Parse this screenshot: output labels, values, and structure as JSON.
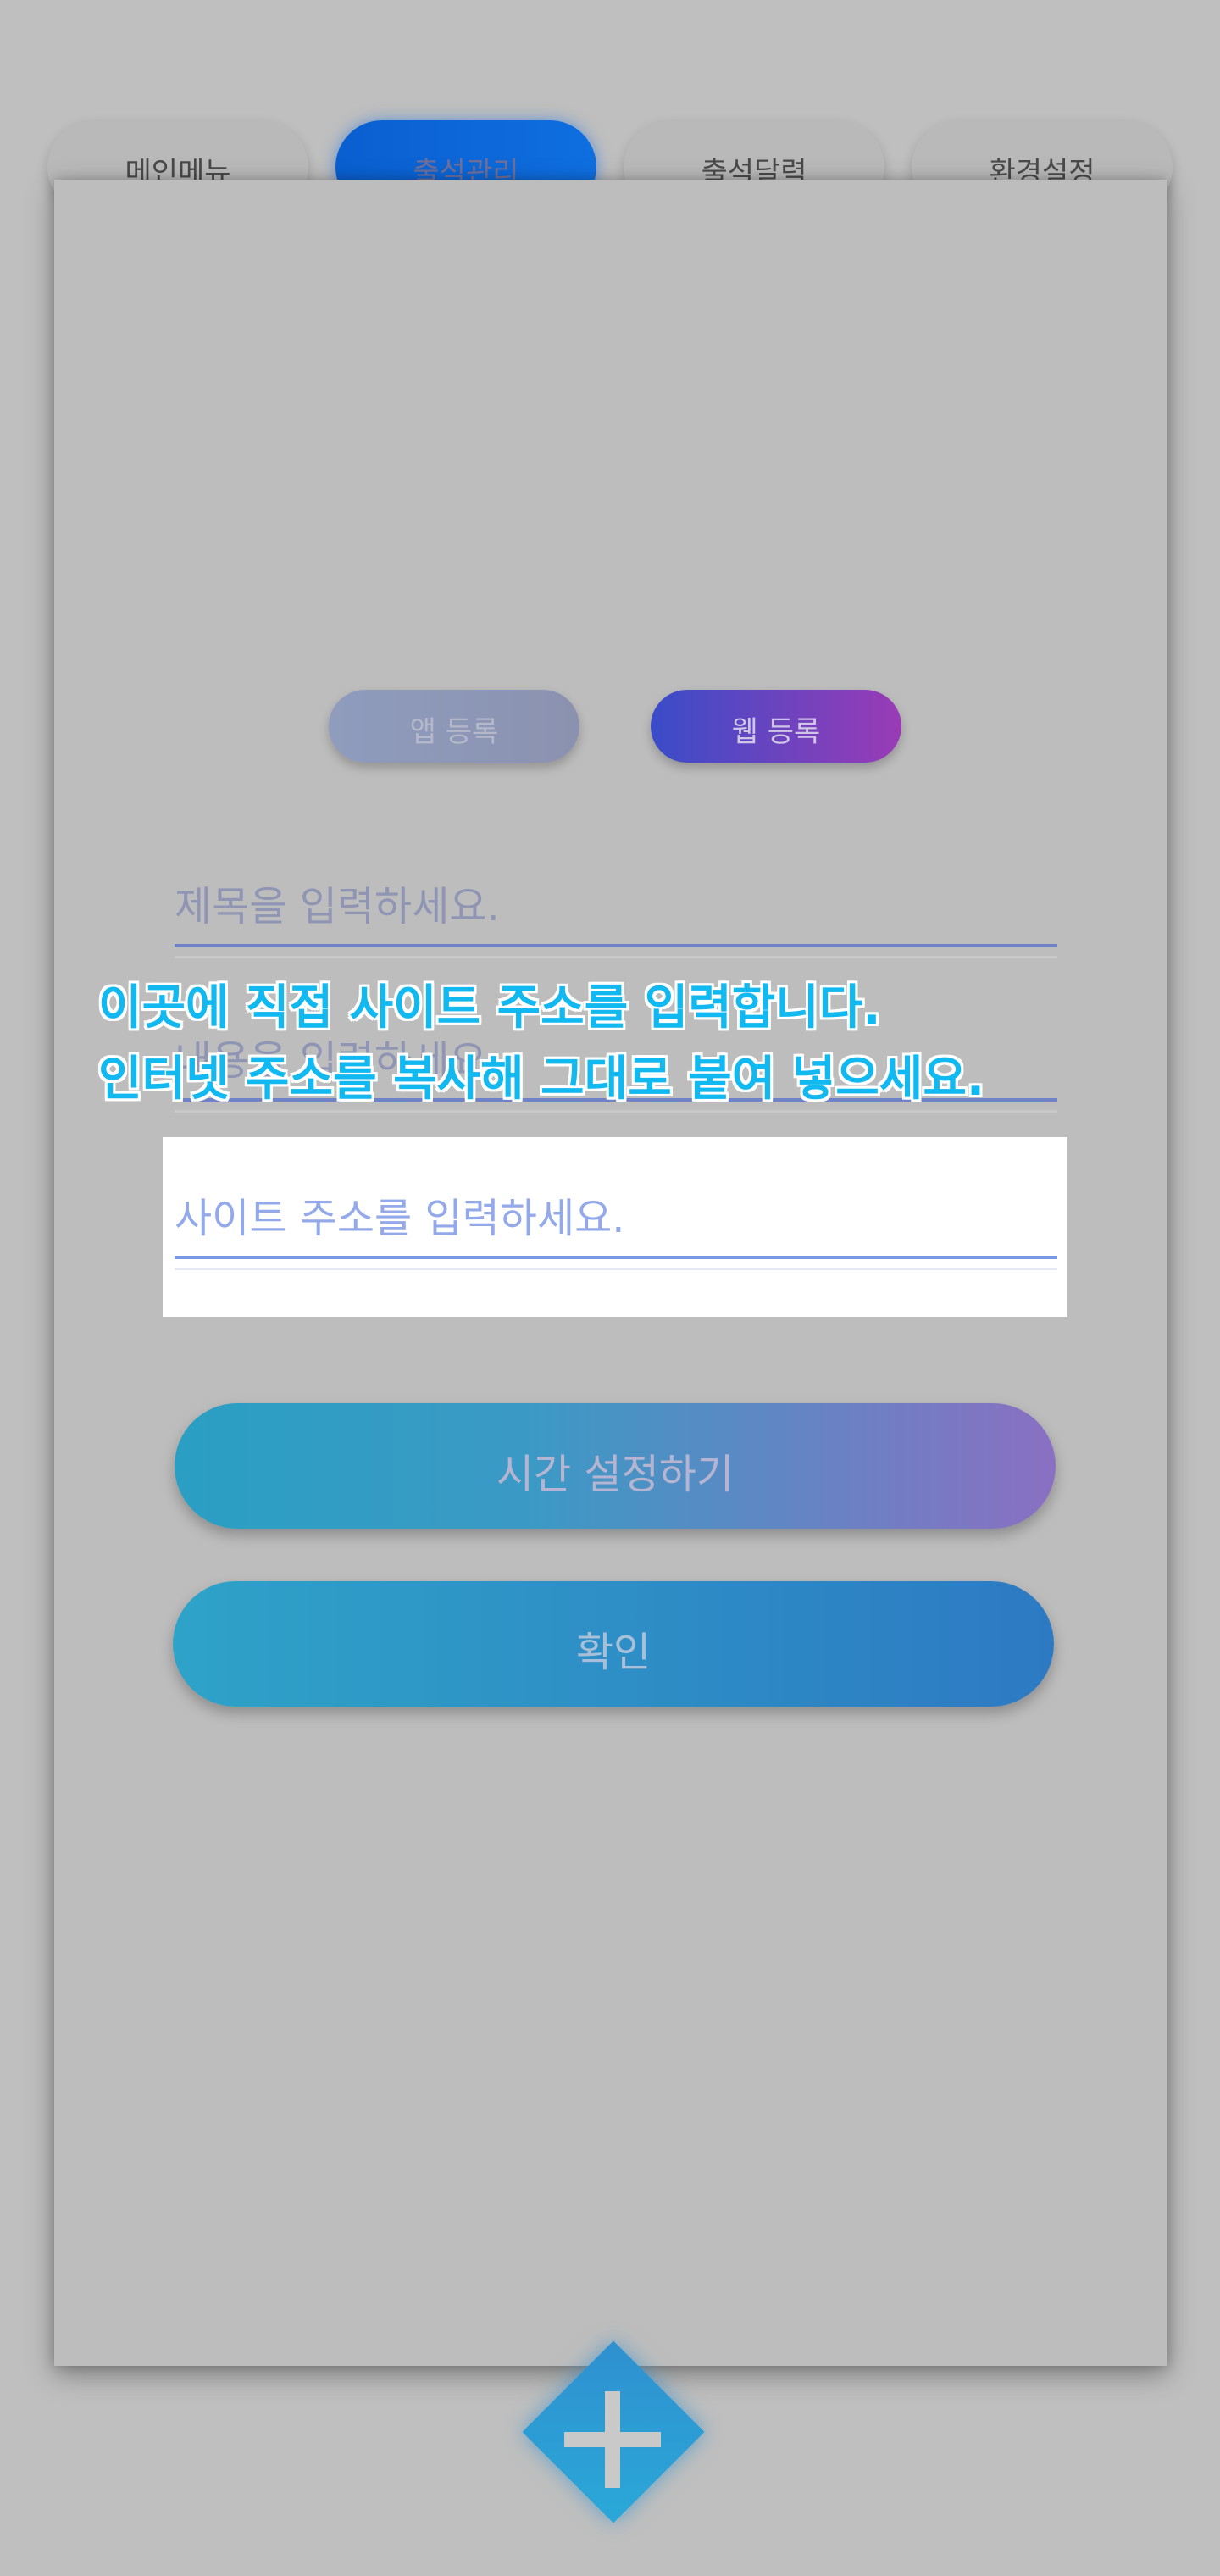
{
  "tabs": [
    {
      "label": "메인메뉴",
      "active": false
    },
    {
      "label": "출석관리",
      "active": true
    },
    {
      "label": "출석달력",
      "active": false
    },
    {
      "label": "환경설정",
      "active": false
    }
  ],
  "register": {
    "app_label": "앱 등록",
    "web_label": "웹 등록"
  },
  "form": {
    "title_placeholder": "제목을 입력하세요.",
    "content_placeholder": "내용을 입력하세요.",
    "url_placeholder": "사이트 주소를 입력하세요."
  },
  "tooltip": {
    "line1": "이곳에 직접 사이트 주소를 입력합니다.",
    "line2": "인터넷 주소를 복사해 그대로 붙여 넣으세요."
  },
  "buttons": {
    "time_setting": "시간 설정하기",
    "confirm": "확인"
  },
  "fab": {
    "icon": "plus-icon"
  },
  "colors": {
    "overlay_bg": "#bfbfbf",
    "tooltip_text": "#12b8f0",
    "active_tab": "#0a5fd0"
  }
}
